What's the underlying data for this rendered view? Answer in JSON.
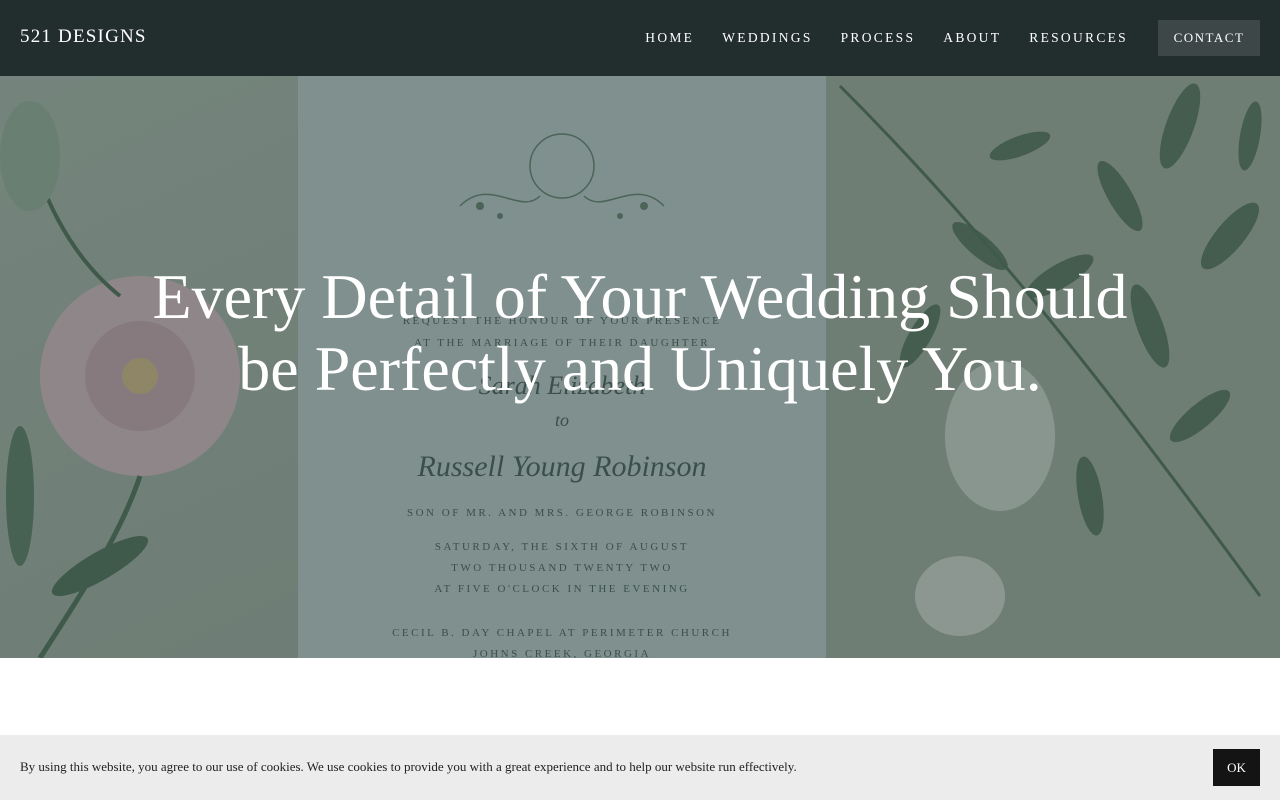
{
  "header": {
    "brand": "521 DESIGNS",
    "nav": [
      {
        "label": "HOME"
      },
      {
        "label": "WEDDINGS"
      },
      {
        "label": "PROCESS"
      },
      {
        "label": "ABOUT"
      },
      {
        "label": "RESOURCES"
      }
    ],
    "contact_label": "CONTACT"
  },
  "hero": {
    "headline": "Every Detail of Your Wedding Should be Perfectly and Uniquely You.",
    "invitation": {
      "line1": "REQUEST THE HONOUR OF YOUR PRESENCE",
      "line2": "AT THE MARRIAGE OF THEIR DAUGHTER",
      "bride": "Sarah Elizabeth",
      "to": "to",
      "groom": "Russell Young Robinson",
      "parents": "SON OF MR. AND MRS. GEORGE ROBINSON",
      "date1": "SATURDAY, THE SIXTH OF AUGUST",
      "date2": "TWO THOUSAND TWENTY TWO",
      "time": "AT FIVE O'CLOCK IN THE EVENING",
      "venue": "CECIL B. DAY CHAPEL AT PERIMETER CHURCH",
      "city": "JOHNS CREEK, GEORGIA"
    }
  },
  "cookie": {
    "text": "By using this website, you agree to our use of cookies. We use cookies to provide you with a great experience and to help our website run effectively.",
    "ok_label": "OK"
  },
  "colors": {
    "header_bg": "#222d2e",
    "contact_bg": "#3d4748",
    "cookie_bg": "#ececec",
    "ok_bg": "#141414"
  }
}
